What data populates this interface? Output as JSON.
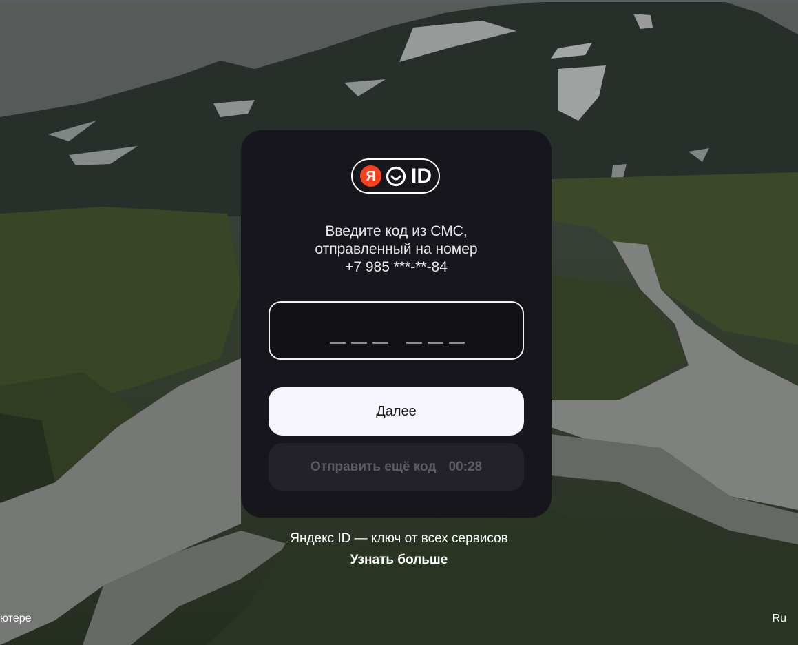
{
  "logo": {
    "ya_letter": "Я",
    "id_text": "ID",
    "brand_color": "#fc3f1d"
  },
  "prompt": {
    "line1": "Введите код из СМС,",
    "line2": "отправленный на номер",
    "phone": "+7 985 ***-**-84"
  },
  "code_input": {
    "value": "",
    "digits": 6
  },
  "buttons": {
    "next_label": "Далее",
    "resend_label": "Отправить ещё код",
    "resend_timer": "00:28"
  },
  "promo": {
    "tagline": "Яндекс ID — ключ от всех сервисов",
    "learn_more": "Узнать больше"
  },
  "footer": {
    "left_text": "ютере",
    "language": "Ru"
  },
  "colors": {
    "card_bg": "#17161c",
    "primary_button": "#f6f5fb",
    "disabled_button": "#232228"
  }
}
